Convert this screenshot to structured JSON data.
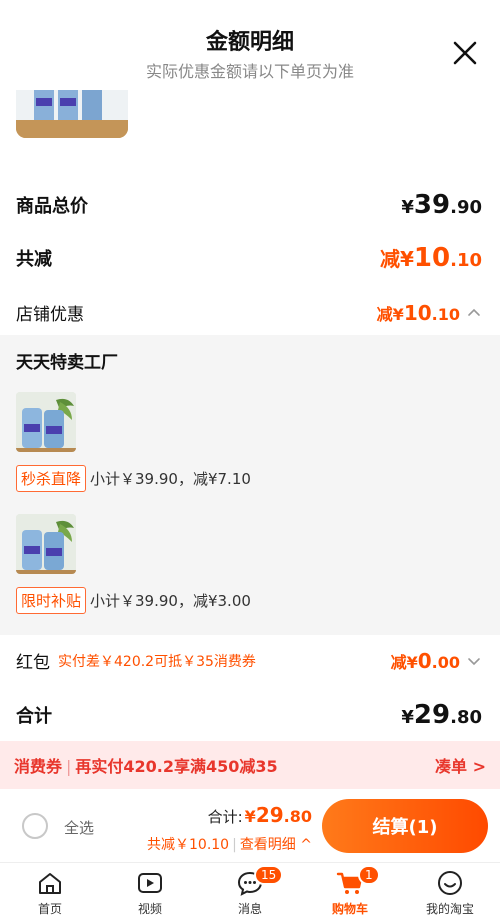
{
  "header": {
    "title": "金额明细",
    "subtitle": "实际优惠金额请以下单页为准"
  },
  "summary": {
    "total_label": "商品总价",
    "total_sym": "¥",
    "total_int": "39",
    "total_dec": ".90",
    "reduce_label": "共减",
    "reduce_prefix": "减¥",
    "reduce_int": "10",
    "reduce_dec": ".10",
    "shop_discount_label": "店铺优惠",
    "shop_discount_prefix": "减¥",
    "shop_discount_int": "10",
    "shop_discount_dec": ".10"
  },
  "shop": {
    "name": "天天特卖工厂",
    "items": [
      {
        "tag": "秒杀直降",
        "text": "小计￥39.90，减¥7.10"
      },
      {
        "tag": "限时补贴",
        "text": "小计￥39.90，减¥3.00"
      }
    ]
  },
  "hongbao": {
    "label": "红包",
    "note": "实付差￥420.2可抵￥35消费券",
    "prefix": "减¥",
    "int": "0",
    "dec": ".00"
  },
  "grand": {
    "label": "合计",
    "sym": "¥",
    "int": "29",
    "dec": ".80"
  },
  "coupon_bar": {
    "left_a": "消费券",
    "sep": "|",
    "left_b": "再实付420.2享满450减35",
    "right": "凑单 >"
  },
  "checkout": {
    "select_all": "全选",
    "total_label": "合计:",
    "total_sym": "¥",
    "total_int": "29",
    "total_dec": ".80",
    "reduce_text": "共减￥10.10",
    "sep": "|",
    "detail_text": "查看明细 ^",
    "button": "结算(1)"
  },
  "tabbar": {
    "items": [
      {
        "label": "首页",
        "icon": "home-icon"
      },
      {
        "label": "视频",
        "icon": "video-icon"
      },
      {
        "label": "消息",
        "icon": "message-icon",
        "badge": "15"
      },
      {
        "label": "购物车",
        "icon": "cart-icon",
        "badge": "1"
      },
      {
        "label": "我的淘宝",
        "icon": "profile-icon"
      }
    ]
  },
  "colors": {
    "accent": "#ff5000",
    "coupon_bg": "#ffeaea",
    "coupon_text": "#e8362c"
  }
}
